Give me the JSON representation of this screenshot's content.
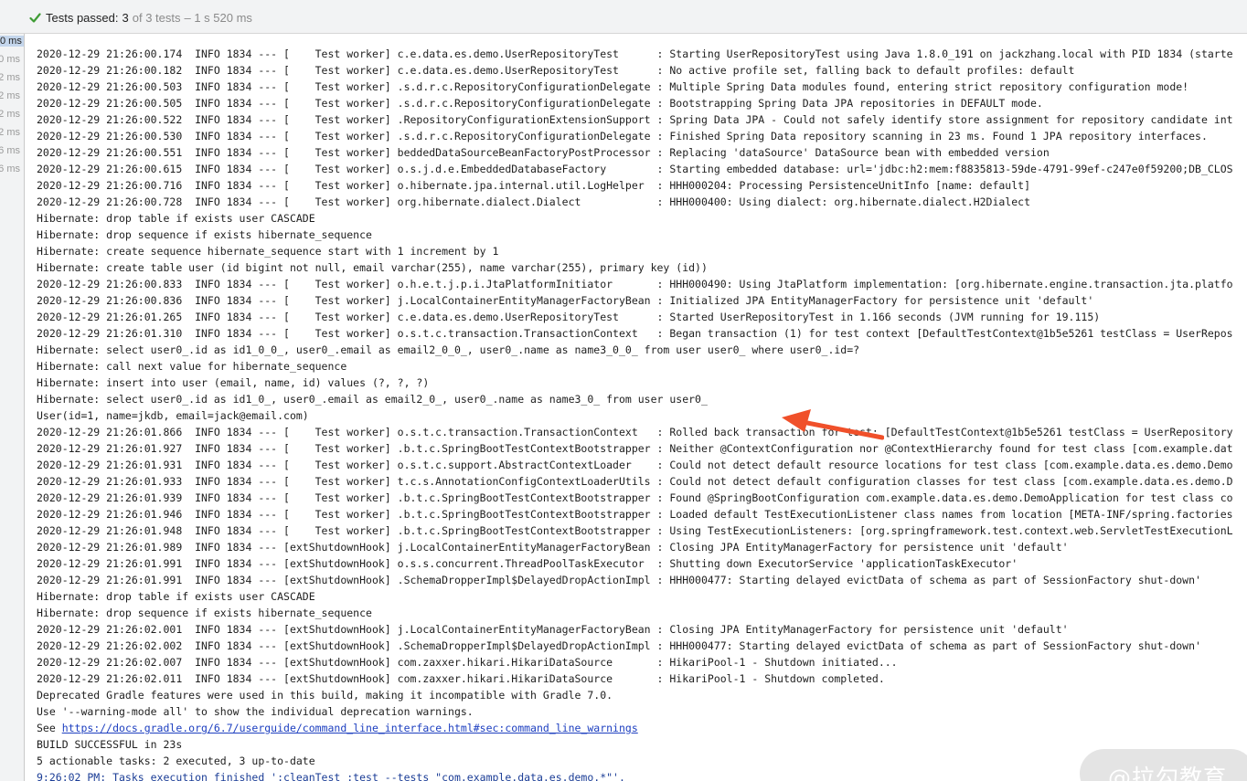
{
  "status": {
    "label": "Tests passed:",
    "count": "3",
    "total": "of 3 tests",
    "time": "– 1 s 520 ms"
  },
  "gutter": {
    "durations": [
      "0 ms",
      "0 ms",
      "2 ms",
      "2 ms",
      "2 ms",
      "2 ms",
      "6 ms",
      "6 ms"
    ],
    "selected_index": 0
  },
  "console": {
    "lines": [
      {
        "text": "2020-12-29 21:26:00.174  INFO 1834 --- [    Test worker] c.e.data.es.demo.UserRepositoryTest      : Starting UserRepositoryTest using Java 1.8.0_191 on jackzhang.local with PID 1834 (starte"
      },
      {
        "text": "2020-12-29 21:26:00.182  INFO 1834 --- [    Test worker] c.e.data.es.demo.UserRepositoryTest      : No active profile set, falling back to default profiles: default"
      },
      {
        "text": "2020-12-29 21:26:00.503  INFO 1834 --- [    Test worker] .s.d.r.c.RepositoryConfigurationDelegate : Multiple Spring Data modules found, entering strict repository configuration mode!"
      },
      {
        "text": "2020-12-29 21:26:00.505  INFO 1834 --- [    Test worker] .s.d.r.c.RepositoryConfigurationDelegate : Bootstrapping Spring Data JPA repositories in DEFAULT mode."
      },
      {
        "text": "2020-12-29 21:26:00.522  INFO 1834 --- [    Test worker] .RepositoryConfigurationExtensionSupport : Spring Data JPA - Could not safely identify store assignment for repository candidate int"
      },
      {
        "text": "2020-12-29 21:26:00.530  INFO 1834 --- [    Test worker] .s.d.r.c.RepositoryConfigurationDelegate : Finished Spring Data repository scanning in 23 ms. Found 1 JPA repository interfaces."
      },
      {
        "text": "2020-12-29 21:26:00.551  INFO 1834 --- [    Test worker] beddedDataSourceBeanFactoryPostProcessor : Replacing 'dataSource' DataSource bean with embedded version"
      },
      {
        "text": "2020-12-29 21:26:00.615  INFO 1834 --- [    Test worker] o.s.j.d.e.EmbeddedDatabaseFactory        : Starting embedded database: url='jdbc:h2:mem:f8835813-59de-4791-99ef-c247e0f59200;DB_CLOS"
      },
      {
        "text": "2020-12-29 21:26:00.716  INFO 1834 --- [    Test worker] o.hibernate.jpa.internal.util.LogHelper  : HHH000204: Processing PersistenceUnitInfo [name: default]"
      },
      {
        "text": "2020-12-29 21:26:00.728  INFO 1834 --- [    Test worker] org.hibernate.dialect.Dialect            : HHH000400: Using dialect: org.hibernate.dialect.H2Dialect"
      },
      {
        "text": "Hibernate: drop table if exists user CASCADE"
      },
      {
        "text": "Hibernate: drop sequence if exists hibernate_sequence"
      },
      {
        "text": "Hibernate: create sequence hibernate_sequence start with 1 increment by 1"
      },
      {
        "text": "Hibernate: create table user (id bigint not null, email varchar(255), name varchar(255), primary key (id))"
      },
      {
        "text": "2020-12-29 21:26:00.833  INFO 1834 --- [    Test worker] o.h.e.t.j.p.i.JtaPlatformInitiator       : HHH000490: Using JtaPlatform implementation: [org.hibernate.engine.transaction.jta.platfo"
      },
      {
        "text": "2020-12-29 21:26:00.836  INFO 1834 --- [    Test worker] j.LocalContainerEntityManagerFactoryBean : Initialized JPA EntityManagerFactory for persistence unit 'default'"
      },
      {
        "text": "2020-12-29 21:26:01.265  INFO 1834 --- [    Test worker] c.e.data.es.demo.UserRepositoryTest      : Started UserRepositoryTest in 1.166 seconds (JVM running for 19.115)"
      },
      {
        "text": "2020-12-29 21:26:01.310  INFO 1834 --- [    Test worker] o.s.t.c.transaction.TransactionContext   : Began transaction (1) for test context [DefaultTestContext@1b5e5261 testClass = UserRepos"
      },
      {
        "text": "Hibernate: select user0_.id as id1_0_0_, user0_.email as email2_0_0_, user0_.name as name3_0_0_ from user user0_ where user0_.id=?"
      },
      {
        "text": "Hibernate: call next value for hibernate_sequence"
      },
      {
        "text": "Hibernate: insert into user (email, name, id) values (?, ?, ?)"
      },
      {
        "text": "Hibernate: select user0_.id as id1_0_, user0_.email as email2_0_, user0_.name as name3_0_ from user user0_"
      },
      {
        "text": "User(id=1, name=jkdb, email=jack@email.com)"
      },
      {
        "text": "2020-12-29 21:26:01.866  INFO 1834 --- [    Test worker] o.s.t.c.transaction.TransactionContext   : Rolled back transaction for test: [DefaultTestContext@1b5e5261 testClass = UserRepository"
      },
      {
        "text": "2020-12-29 21:26:01.927  INFO 1834 --- [    Test worker] .b.t.c.SpringBootTestContextBootstrapper : Neither @ContextConfiguration nor @ContextHierarchy found for test class [com.example.dat"
      },
      {
        "text": "2020-12-29 21:26:01.931  INFO 1834 --- [    Test worker] o.s.t.c.support.AbstractContextLoader    : Could not detect default resource locations for test class [com.example.data.es.demo.Demo"
      },
      {
        "text": "2020-12-29 21:26:01.933  INFO 1834 --- [    Test worker] t.c.s.AnnotationConfigContextLoaderUtils : Could not detect default configuration classes for test class [com.example.data.es.demo.D"
      },
      {
        "text": "2020-12-29 21:26:01.939  INFO 1834 --- [    Test worker] .b.t.c.SpringBootTestContextBootstrapper : Found @SpringBootConfiguration com.example.data.es.demo.DemoApplication for test class co"
      },
      {
        "text": "2020-12-29 21:26:01.946  INFO 1834 --- [    Test worker] .b.t.c.SpringBootTestContextBootstrapper : Loaded default TestExecutionListener class names from location [META-INF/spring.factories"
      },
      {
        "text": "2020-12-29 21:26:01.948  INFO 1834 --- [    Test worker] .b.t.c.SpringBootTestContextBootstrapper : Using TestExecutionListeners: [org.springframework.test.context.web.ServletTestExecutionL"
      },
      {
        "text": "2020-12-29 21:26:01.989  INFO 1834 --- [extShutdownHook] j.LocalContainerEntityManagerFactoryBean : Closing JPA EntityManagerFactory for persistence unit 'default'"
      },
      {
        "text": "2020-12-29 21:26:01.991  INFO 1834 --- [extShutdownHook] o.s.s.concurrent.ThreadPoolTaskExecutor  : Shutting down ExecutorService 'applicationTaskExecutor'"
      },
      {
        "text": "2020-12-29 21:26:01.991  INFO 1834 --- [extShutdownHook] .SchemaDropperImpl$DelayedDropActionImpl : HHH000477: Starting delayed evictData of schema as part of SessionFactory shut-down'"
      },
      {
        "text": "Hibernate: drop table if exists user CASCADE"
      },
      {
        "text": "Hibernate: drop sequence if exists hibernate_sequence"
      },
      {
        "text": "2020-12-29 21:26:02.001  INFO 1834 --- [extShutdownHook] j.LocalContainerEntityManagerFactoryBean : Closing JPA EntityManagerFactory for persistence unit 'default'"
      },
      {
        "text": "2020-12-29 21:26:02.002  INFO 1834 --- [extShutdownHook] .SchemaDropperImpl$DelayedDropActionImpl : HHH000477: Starting delayed evictData of schema as part of SessionFactory shut-down'"
      },
      {
        "text": "2020-12-29 21:26:02.007  INFO 1834 --- [extShutdownHook] com.zaxxer.hikari.HikariDataSource       : HikariPool-1 - Shutdown initiated..."
      },
      {
        "text": "2020-12-29 21:26:02.011  INFO 1834 --- [extShutdownHook] com.zaxxer.hikari.HikariDataSource       : HikariPool-1 - Shutdown completed."
      },
      {
        "text": "Deprecated Gradle features were used in this build, making it incompatible with Gradle 7.0."
      },
      {
        "text": "Use '--warning-mode all' to show the individual deprecation warnings."
      },
      {
        "text": "See ",
        "link": "https://docs.gradle.org/6.7/userguide/command_line_interface.html#sec:command_line_warnings"
      },
      {
        "text": "BUILD SUCCESSFUL in 23s"
      },
      {
        "text": "5 actionable tasks: 2 executed, 3 up-to-date"
      },
      {
        "text": "9:26:02 PM: Tasks execution finished ':cleanTest :test --tests \"com.example.data.es.demo.*\"'.",
        "style": "blue"
      }
    ]
  },
  "watermark": "@拉勾教育",
  "colors": {
    "pass_check": "#3f9c35",
    "arrow": "#f0502a",
    "link": "#1d3fc0",
    "finished_line": "#1b3d96"
  }
}
